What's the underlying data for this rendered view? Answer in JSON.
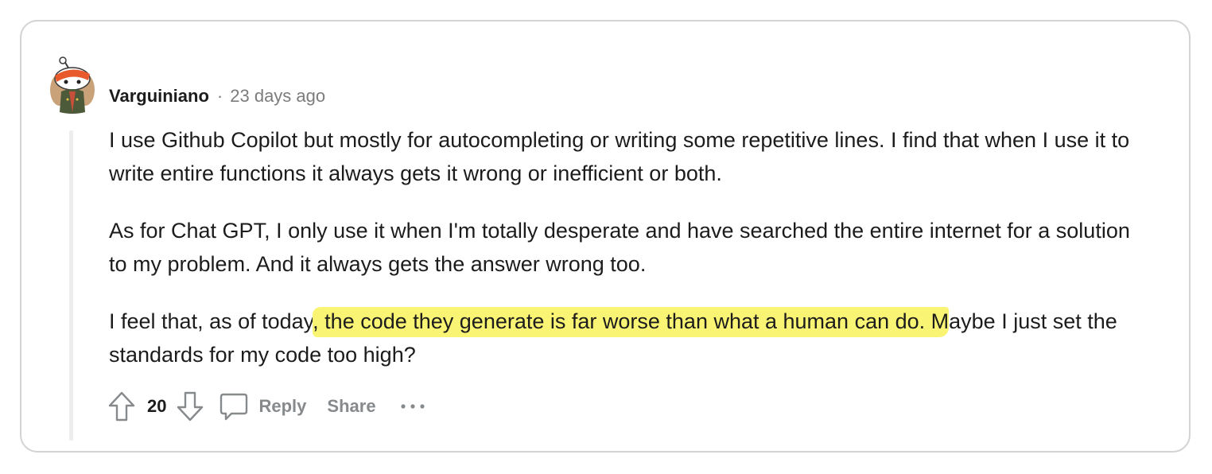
{
  "comment": {
    "username": "Varguiniano",
    "separator": "·",
    "timestamp": "23 days ago",
    "paragraphs": {
      "p1": "I use Github Copilot but mostly for autocompleting or writing some repetitive lines. I find that when I use it to write entire functions it always gets it wrong or inefficient or both.",
      "p2": "As for Chat GPT, I only use it when I'm totally desperate and have searched the entire internet for a solution to my problem. And it always gets the answer wrong too.",
      "p3_before": "I feel that, as of today",
      "p3_highlight": ", the code they generate is far worse than what a human can do. M",
      "p3_after": "aybe I just set the standards for my code too high?"
    },
    "highlight_color": "#faf475"
  },
  "actions": {
    "score": "20",
    "reply_label": "Reply",
    "share_label": "Share",
    "upvote_icon": "arrow-up-icon",
    "downvote_icon": "arrow-down-icon",
    "reply_icon": "comment-bubble-icon",
    "more_icon": "more-dots-icon"
  }
}
